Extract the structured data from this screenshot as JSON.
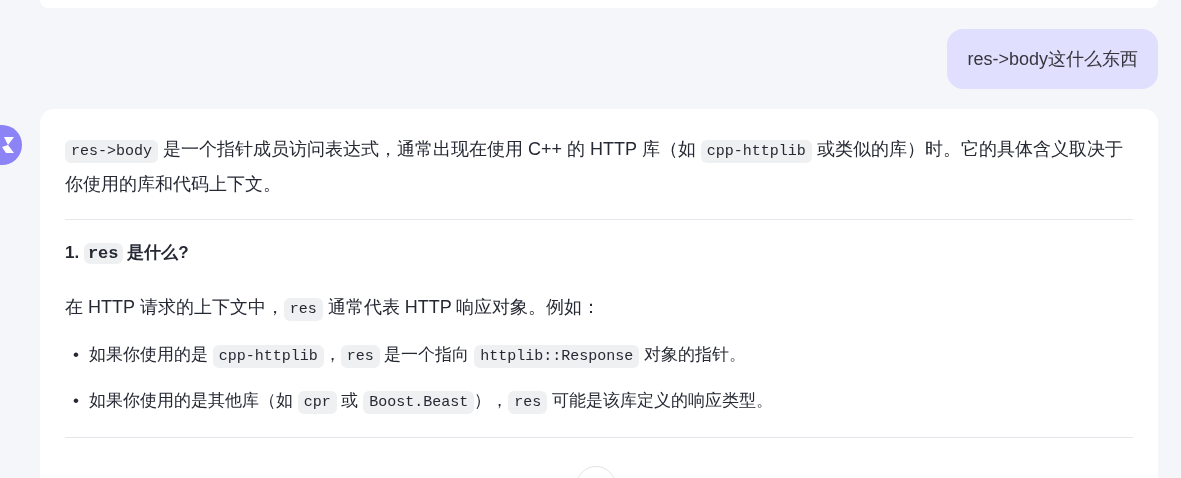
{
  "user_message": {
    "text": "res->body这什么东西"
  },
  "answer": {
    "blocks": [
      {
        "kind": "paragraph",
        "segments": [
          {
            "kind": "code",
            "text": "res->body"
          },
          {
            "kind": "text",
            "text": " 是一个指针成员访问表达式，通常出现在使用 C++ 的 HTTP 库（如 "
          },
          {
            "kind": "code",
            "text": "cpp-httplib"
          },
          {
            "kind": "text",
            "text": " 或类似的库）时。它的具体含义取决于你使用的库和代码上下文。"
          }
        ]
      },
      {
        "kind": "divider"
      },
      {
        "kind": "heading",
        "segments": [
          {
            "kind": "text",
            "text": "1. "
          },
          {
            "kind": "code",
            "text": "res"
          },
          {
            "kind": "text",
            "text": " 是什么?"
          }
        ]
      },
      {
        "kind": "paragraph",
        "segments": [
          {
            "kind": "text",
            "text": "在 HTTP 请求的上下文中，"
          },
          {
            "kind": "code",
            "text": "res"
          },
          {
            "kind": "text",
            "text": " 通常代表 HTTP 响应对象。例如："
          }
        ]
      },
      {
        "kind": "bullets",
        "items": [
          {
            "marker": "•",
            "segments": [
              {
                "kind": "text",
                "text": "如果你使用的是 "
              },
              {
                "kind": "code",
                "text": "cpp-httplib"
              },
              {
                "kind": "text",
                "text": "，"
              },
              {
                "kind": "code",
                "text": "res"
              },
              {
                "kind": "text",
                "text": " 是一个指向 "
              },
              {
                "kind": "code",
                "text": "httplib::Response"
              },
              {
                "kind": "text",
                "text": " 对象的指针。"
              }
            ]
          },
          {
            "marker": "•",
            "segments": [
              {
                "kind": "text",
                "text": "如果你使用的是其他库（如 "
              },
              {
                "kind": "code",
                "text": "cpr"
              },
              {
                "kind": "text",
                "text": " 或 "
              },
              {
                "kind": "code",
                "text": "Boost.Beast"
              },
              {
                "kind": "text",
                "text": "），"
              },
              {
                "kind": "code",
                "text": "res"
              },
              {
                "kind": "text",
                "text": " 可能是该库定义的响应类型。"
              }
            ]
          }
        ]
      },
      {
        "kind": "divider"
      }
    ]
  }
}
